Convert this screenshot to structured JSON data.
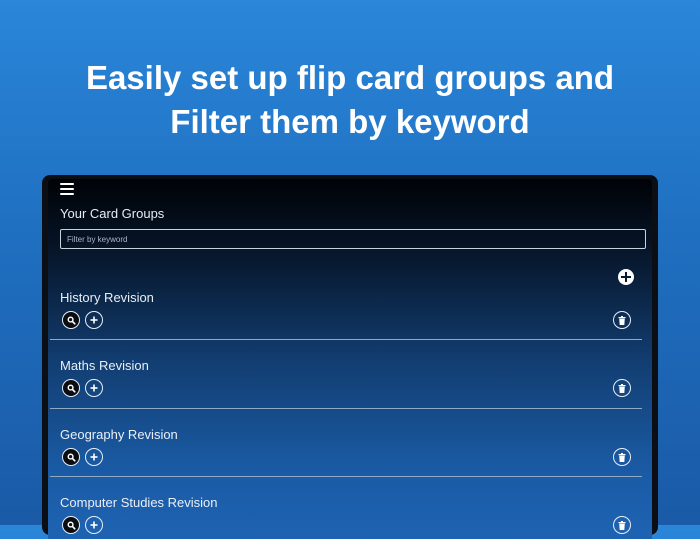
{
  "headline": {
    "line1": "Easily set up flip card groups and",
    "line2": "Filter them by keyword"
  },
  "app": {
    "section_title": "Your Card Groups",
    "filter_placeholder": "Filter by keyword",
    "icons": {
      "menu": "hamburger-menu-icon",
      "add_group": "plus-circle-icon",
      "search": "magnifier-icon",
      "add_card": "plus-icon",
      "delete": "trash-icon"
    },
    "groups": [
      {
        "name": "History Revision"
      },
      {
        "name": "Maths Revision"
      },
      {
        "name": "Geography Revision"
      },
      {
        "name": "Computer Studies Revision"
      }
    ]
  },
  "colors": {
    "background_top": "#2a86d9",
    "background_bottom": "#1a5aa6",
    "screen_dark": "#000307",
    "screen_blue": "#1e63b3"
  }
}
